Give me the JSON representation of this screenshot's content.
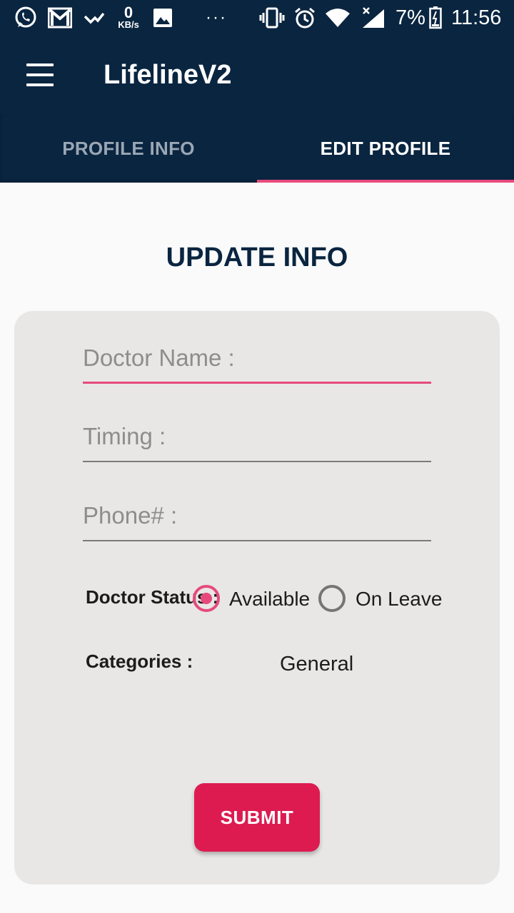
{
  "status_bar": {
    "kb_value": "0",
    "kb_unit": "KB/s",
    "dots": "···",
    "battery_percent": "7%",
    "time": "11:56",
    "icons": [
      "whatsapp-icon",
      "gmail-icon",
      "check-notification-icon",
      "data-speed-indicator",
      "image-icon",
      "vibrate-icon",
      "alarm-icon",
      "wifi-icon",
      "signal-icon",
      "battery-icon"
    ]
  },
  "app_bar": {
    "title": "LifelineV2",
    "menu_icon": "hamburger-menu-icon"
  },
  "tabs": [
    {
      "label": "PROFILE INFO",
      "active": false
    },
    {
      "label": "EDIT PROFILE",
      "active": true
    }
  ],
  "page": {
    "heading": "UPDATE INFO"
  },
  "form": {
    "doctor_name": {
      "placeholder": "Doctor Name :",
      "value": ""
    },
    "timing": {
      "placeholder": "Timing :",
      "value": ""
    },
    "phone": {
      "placeholder": "Phone# :",
      "value": ""
    },
    "status_label": "Doctor Status :",
    "status_options": [
      {
        "label": "Available",
        "checked": true
      },
      {
        "label": "On Leave",
        "checked": false
      }
    ],
    "categories_label": "Categories :",
    "categories_value": "General",
    "submit_label": "SUBMIT"
  },
  "colors": {
    "primary_dark": "#0a2540",
    "accent_pink": "#e64a7b",
    "submit_red": "#dd1b50",
    "card_gray": "#e8e7e6"
  }
}
